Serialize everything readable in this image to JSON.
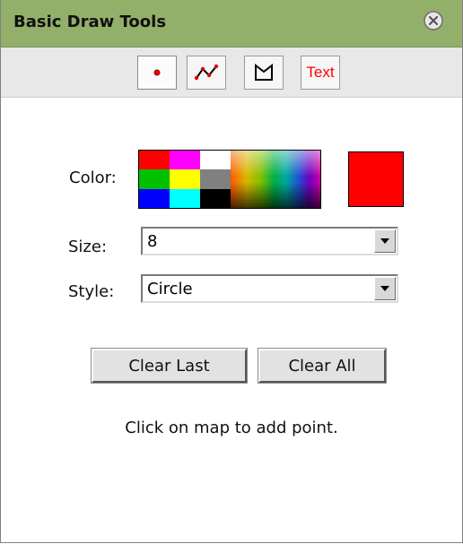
{
  "panel": {
    "title": "Basic Draw Tools",
    "close_icon": "close-circle-icon"
  },
  "toolbar": {
    "tools": [
      {
        "name": "point",
        "icon": "point-icon",
        "active": true
      },
      {
        "name": "line",
        "icon": "polyline-icon"
      },
      {
        "name": "polygon",
        "icon": "polygon-icon"
      },
      {
        "name": "text",
        "label": "Text"
      }
    ]
  },
  "color": {
    "label": "Color:",
    "selected": "#ff0000",
    "palette": [
      "#ff0000",
      "#ff00ff",
      "#ffffff",
      "#00c000",
      "#ffff00",
      "#808080",
      "#0000ff",
      "#00ffff",
      "#000000"
    ]
  },
  "size": {
    "label": "Size:",
    "value": "8"
  },
  "style": {
    "label": "Style:",
    "value": "Circle"
  },
  "buttons": {
    "clear_last": "Clear Last",
    "clear_all": "Clear All"
  },
  "hint": "Click on map to add point."
}
